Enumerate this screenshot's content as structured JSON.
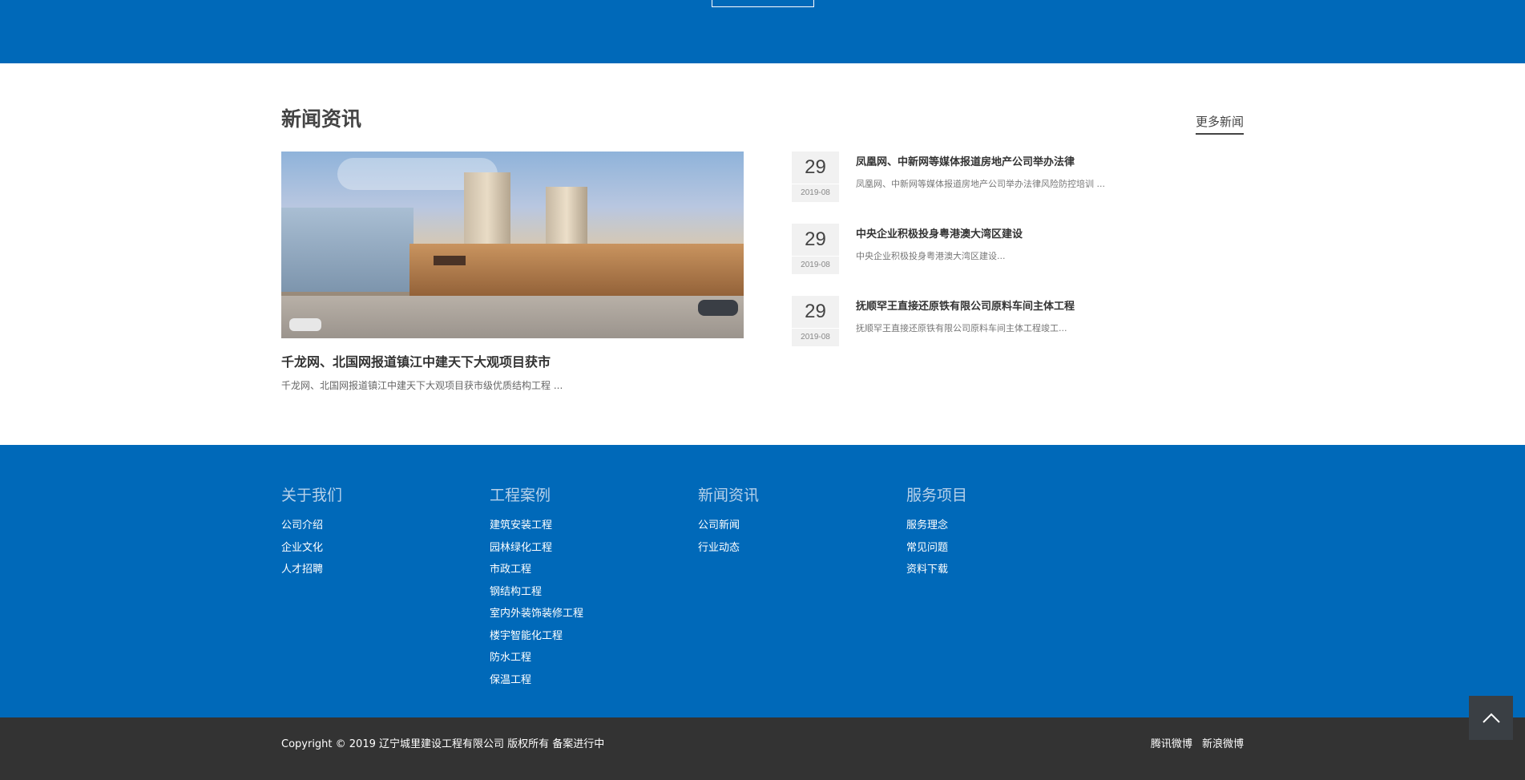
{
  "news": {
    "section_title": "新闻资讯",
    "more_label": "更多新闻",
    "feature": {
      "headline": "千龙网、北国网报道镇江中建天下大观项目获市",
      "summary": "千龙网、北国网报道镇江中建天下大观项目获市级优质结构工程 ..."
    },
    "items": [
      {
        "day": "29",
        "year_month": "2019-08",
        "title": "凤凰网、中新网等媒体报道房地产公司举办法律",
        "summary": "凤凰网、中新网等媒体报道房地产公司举办法律风险防控培训 ..."
      },
      {
        "day": "29",
        "year_month": "2019-08",
        "title": "中央企业积极投身粤港澳大湾区建设",
        "summary": "中央企业积极投身粤港澳大湾区建设..."
      },
      {
        "day": "29",
        "year_month": "2019-08",
        "title": "抚顺罕王直接还原铁有限公司原料车间主体工程",
        "summary": "抚顺罕王直接还原铁有限公司原料车间主体工程竣工..."
      }
    ]
  },
  "footer": {
    "columns": [
      {
        "title": "关于我们",
        "links": [
          "公司介绍",
          "企业文化",
          "人才招聘"
        ]
      },
      {
        "title": "工程案例",
        "links": [
          "建筑安装工程",
          "园林绿化工程",
          "市政工程",
          "钢结构工程",
          "室内外装饰装修工程",
          "楼宇智能化工程",
          "防水工程",
          "保温工程"
        ]
      },
      {
        "title": "新闻资讯",
        "links": [
          "公司新闻",
          "行业动态"
        ]
      },
      {
        "title": "服务项目",
        "links": [
          "服务理念",
          "常见问题",
          "资料下载"
        ]
      }
    ]
  },
  "bottom": {
    "copyright": "Copyright © 2019 辽宁城里建设工程有限公司 版权所有  备案进行中",
    "social": [
      "腾讯微博",
      "新浪微博"
    ]
  },
  "colors": {
    "brand_blue": "#0069b9",
    "bottom_bar": "#333333",
    "back_top": "#3a3f44"
  },
  "icons": {
    "back_to_top": "chevron-up-icon"
  }
}
